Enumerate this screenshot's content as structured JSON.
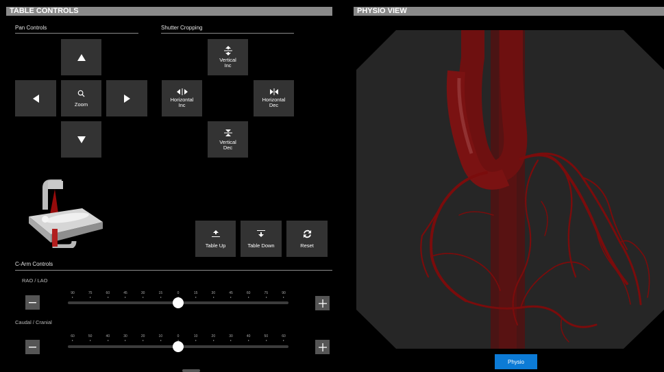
{
  "table_controls": {
    "title": "TABLE CONTROLS",
    "pan": {
      "heading": "Pan Controls",
      "zoom_label": "Zoom"
    },
    "shutter": {
      "heading": "Shutter Cropping",
      "vertical_inc": "Vertical\nInc",
      "horizontal_inc": "Horizontal\nInc",
      "horizontal_dec": "Horizontal\nDec",
      "vertical_dec": "Vertical\nDec"
    },
    "actions": {
      "table_up": "Table Up",
      "table_down": "Table Down",
      "reset": "Reset"
    }
  },
  "carm": {
    "heading": "C-Arm Controls",
    "rao_lao": {
      "label": "RAO / LAO",
      "ticks": [
        "90",
        "75",
        "60",
        "45",
        "30",
        "15",
        "0",
        "15",
        "30",
        "45",
        "60",
        "75",
        "90"
      ],
      "value": 0
    },
    "caudal_cranial": {
      "label": "Caudal / Cranial",
      "ticks": [
        "60",
        "50",
        "40",
        "30",
        "20",
        "10",
        "0",
        "10",
        "20",
        "30",
        "40",
        "50",
        "60"
      ],
      "value": 0
    }
  },
  "physio_view": {
    "title": "PHYSIO VIEW",
    "button_label": "Physio"
  },
  "colors": {
    "header_bar": "#8a8a8a",
    "button_bg": "#333333",
    "accent_blue": "#0c7bd6",
    "vessel_red": "#7a0c0c"
  }
}
